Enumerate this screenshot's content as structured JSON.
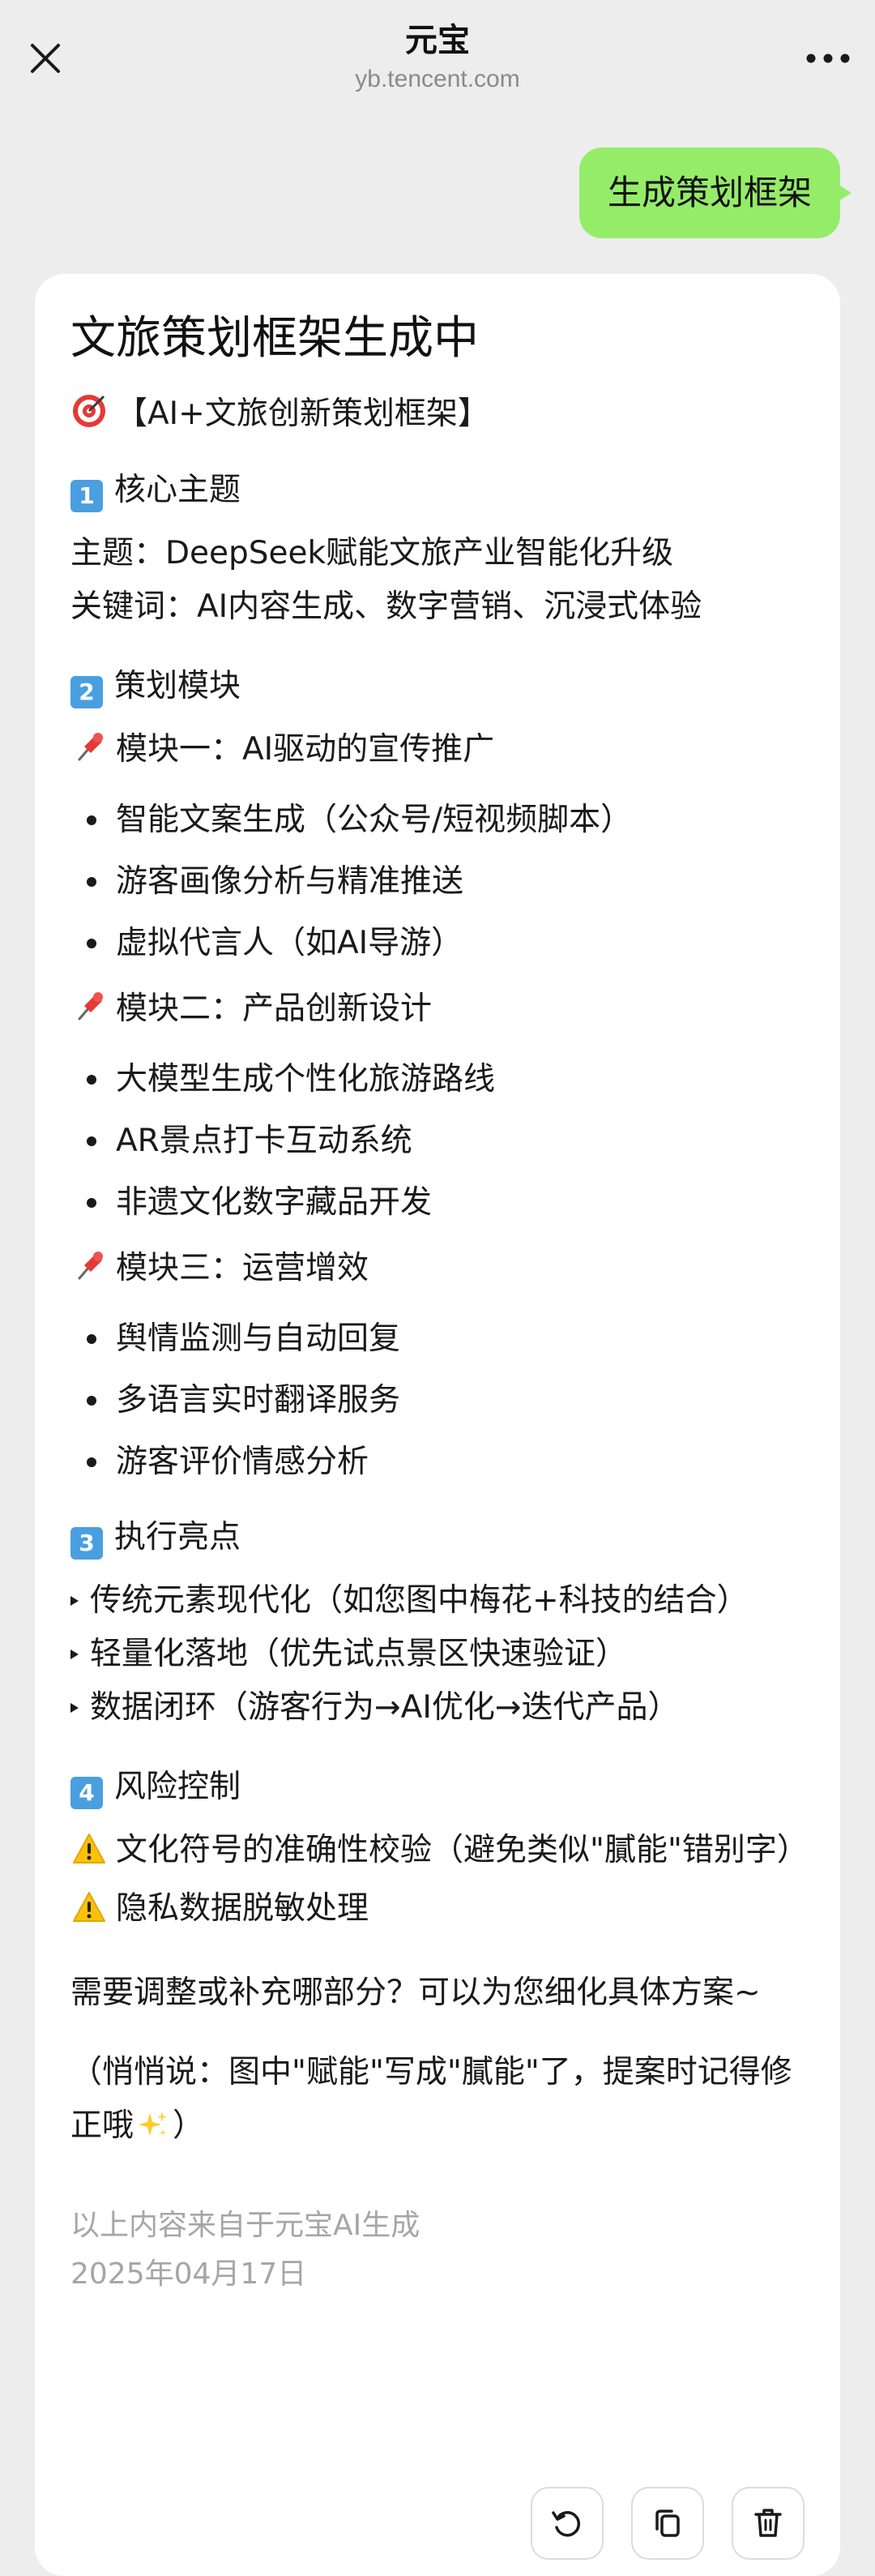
{
  "header": {
    "title": "元宝",
    "subtitle": "yb.tencent.com"
  },
  "user_message": "生成策划框架",
  "response": {
    "title": "文旅策划框架生成中",
    "framework_title": "【AI+文旅创新策划框架】",
    "sections": {
      "s1": {
        "number": "1",
        "heading": "核心主题",
        "lines": [
          "主题：DeepSeek赋能文旅产业智能化升级",
          "关键词：AI内容生成、数字营销、沉浸式体验"
        ]
      },
      "s2": {
        "number": "2",
        "heading": "策划模块",
        "modules": [
          {
            "title": "模块一：AI驱动的宣传推广",
            "items": [
              "智能文案生成（公众号/短视频脚本）",
              "游客画像分析与精准推送",
              "虚拟代言人（如AI导游）"
            ]
          },
          {
            "title": "模块二：产品创新设计",
            "items": [
              "大模型生成个性化旅游路线",
              "AR景点打卡互动系统",
              "非遗文化数字藏品开发"
            ]
          },
          {
            "title": "模块三：运营增效",
            "items": [
              "舆情监测与自动回复",
              "多语言实时翻译服务",
              "游客评价情感分析"
            ]
          }
        ]
      },
      "s3": {
        "number": "3",
        "heading": "执行亮点",
        "items": [
          "传统元素现代化（如您图中梅花+科技的结合）",
          "轻量化落地（优先试点景区快速验证）",
          "数据闭环（游客行为→AI优化→迭代产品）"
        ]
      },
      "s4": {
        "number": "4",
        "heading": "风险控制",
        "items": [
          "文化符号的准确性校验（避免类似\"膩能\"错别字）",
          "隐私数据脱敏处理"
        ]
      }
    },
    "closing_question": "需要调整或补充哪部分？可以为您细化具体方案~",
    "aside": "（悄悄说：图中\"赋能\"写成\"膩能\"了，提案时记得修正哦",
    "aside_end": "）"
  },
  "footer": {
    "source_note": "以上内容来自于元宝AI生成",
    "date": "2025年04月17日"
  },
  "icons": {
    "close": "close-icon",
    "more": "more-icon",
    "target": "target-icon",
    "pin": "pushpin-icon",
    "warning": "warning-icon",
    "sparkles": "sparkles-icon",
    "refresh": "refresh-icon",
    "copy": "copy-icon",
    "delete": "trash-icon"
  },
  "colors": {
    "user_bubble": "#95ec69",
    "keycap": "#4a9fe0",
    "background": "#ededed"
  }
}
